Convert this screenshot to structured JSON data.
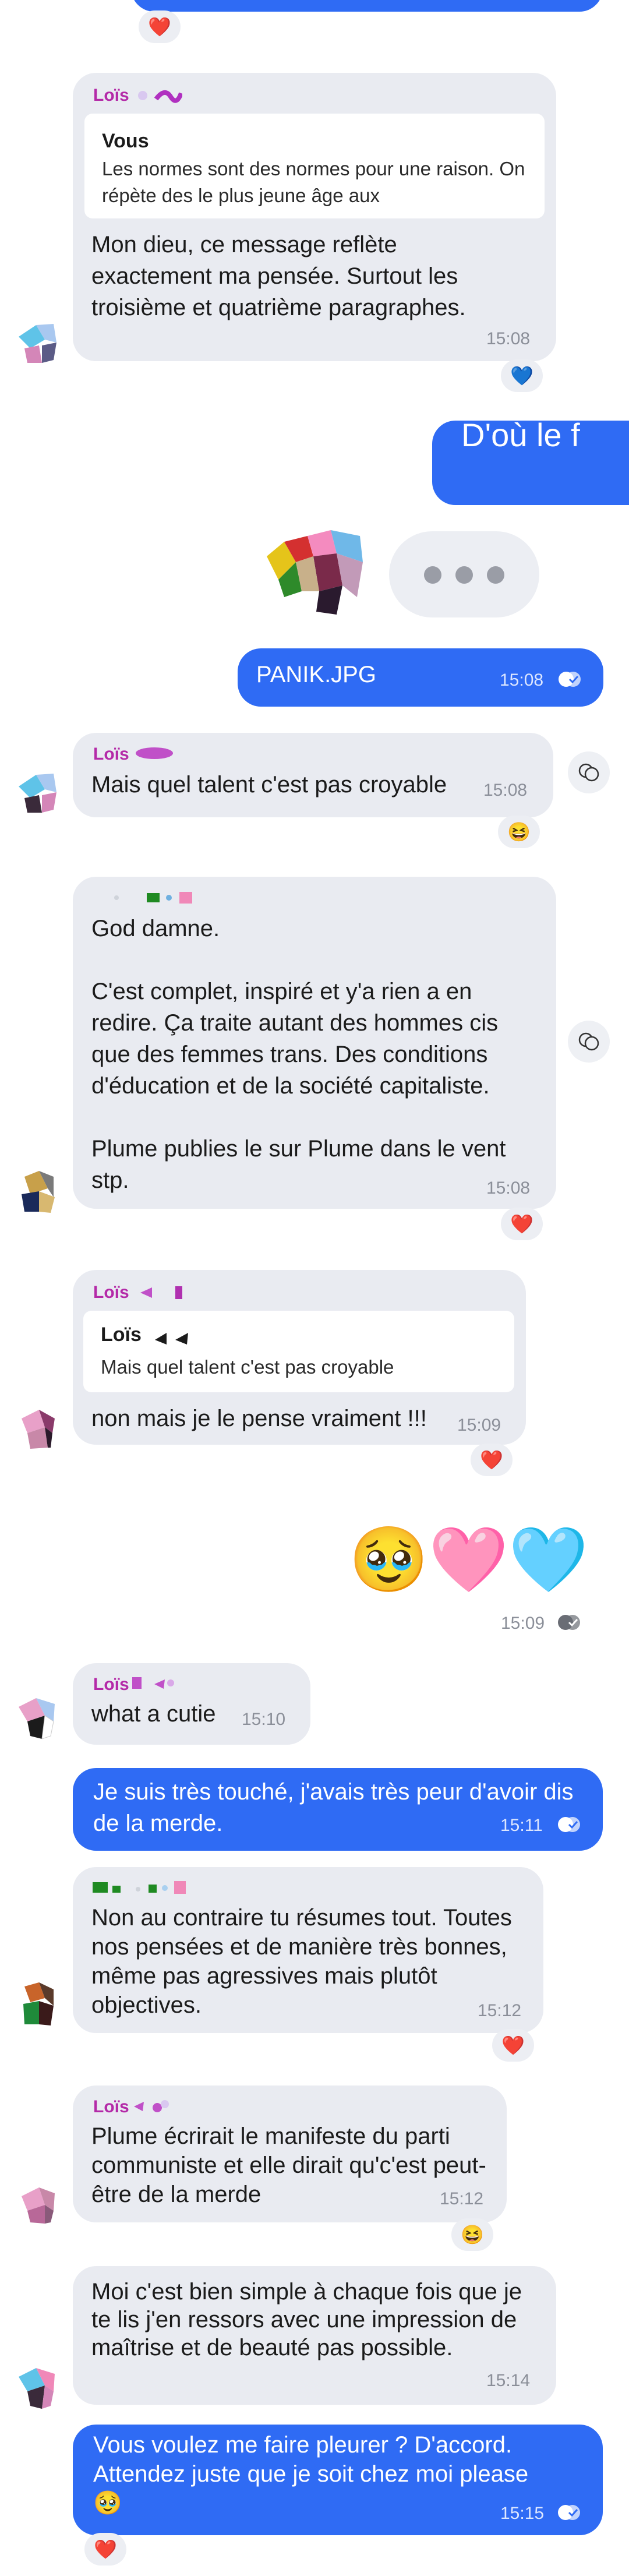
{
  "colors": {
    "incoming_bubble": "#e9ebf1",
    "outgoing_bubble": "#2f6bf4",
    "sender_name": "#b42aa8",
    "time": "#8b8f99"
  },
  "reactions": {
    "heart": "❤️",
    "blue_heart": "💙",
    "laugh": "😆",
    "pleading": "🥹"
  },
  "messages": [
    {
      "id": "m1",
      "direction": "in",
      "sender": "Loïs",
      "quote_name": "Vous",
      "quote_text": "Les normes sont des normes pour une raison. On répète des le plus jeune âge aux",
      "text": "Mon dieu, ce message reflète exactement ma pensée. Surtout les troisième et quatrième paragraphes.",
      "time": "15:08",
      "reaction": "💙"
    },
    {
      "id": "m2",
      "direction": "out",
      "text": "D'où le f",
      "partial": true
    },
    {
      "id": "m3",
      "direction": "out",
      "text": "PANIK.JPG",
      "time": "15:08"
    },
    {
      "id": "m4",
      "direction": "in",
      "sender": "Loïs",
      "text": "Mais quel talent c'est pas croyable",
      "time": "15:08",
      "reaction": "😆"
    },
    {
      "id": "m5",
      "direction": "in",
      "sender": "",
      "text": "God damne.\n\nC'est complet, inspiré et y'a rien a en redire. Ça traite autant des hommes cis que des femmes trans. Des conditions d'éducation et de la société capitaliste.\n\nPlume publies le sur Plume dans le vent stp.",
      "time": "15:08",
      "reaction": "❤️"
    },
    {
      "id": "m6",
      "direction": "in",
      "sender": "Loïs",
      "quote_name": "Loïs",
      "quote_text": "Mais quel talent c'est pas croyable",
      "text": "non mais je le pense vraiment !!!",
      "time": "15:09",
      "reaction": "❤️"
    },
    {
      "id": "m7",
      "direction": "out",
      "text": "🥹🩷🩵",
      "time": "15:09"
    },
    {
      "id": "m8",
      "direction": "in",
      "sender": "Loïs",
      "text": "what a cutie",
      "time": "15:10"
    },
    {
      "id": "m9",
      "direction": "out",
      "text": "Je suis très touché, j'avais très peur d'avoir dis de la merde.",
      "time": "15:11"
    },
    {
      "id": "m10",
      "direction": "in",
      "sender": "",
      "text": "Non au contraire tu résumes tout. Toutes nos pensées et de manière très bonnes, même pas agressives mais plutôt objectives.",
      "time": "15:12",
      "reaction": "❤️"
    },
    {
      "id": "m11",
      "direction": "in",
      "sender": "Loïs",
      "text": "Plume écrirait le manifeste du parti communiste et elle dirait qu'c'est peut-être de la merde",
      "time": "15:12",
      "reaction": "😆"
    },
    {
      "id": "m12",
      "direction": "in",
      "sender": "",
      "text": "Moi c'est bien simple à chaque fois que je te lis j'en ressors avec une impression de maîtrise et de beauté pas possible.",
      "time": "15:14"
    },
    {
      "id": "m13",
      "direction": "out",
      "text": "Vous voulez me faire pleurer ? D'accord. Attendez juste que je soit chez moi please\n🥹",
      "time": "15:15",
      "reaction": "❤️"
    }
  ]
}
